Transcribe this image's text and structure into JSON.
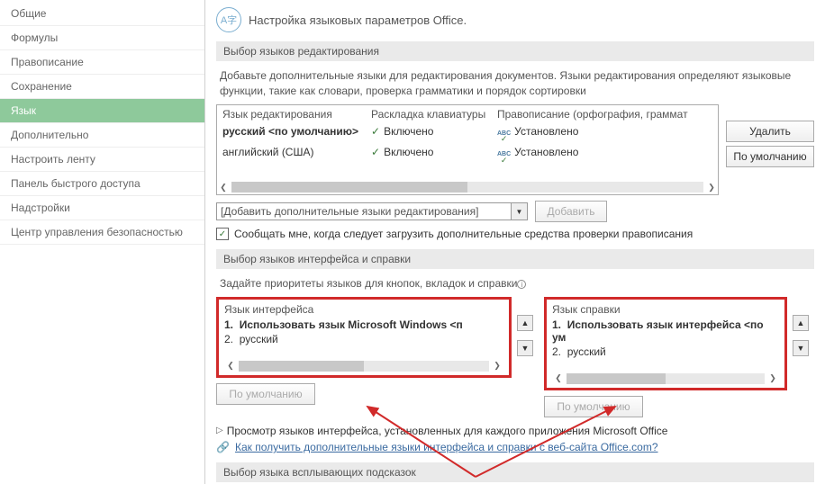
{
  "sidebar": {
    "items": [
      {
        "label": "Общие"
      },
      {
        "label": "Формулы"
      },
      {
        "label": "Правописание"
      },
      {
        "label": "Сохранение"
      },
      {
        "label": "Язык",
        "selected": true
      },
      {
        "label": "Дополнительно"
      },
      {
        "label": "Настроить ленту"
      },
      {
        "label": "Панель быстрого доступа"
      },
      {
        "label": "Надстройки"
      },
      {
        "label": "Центр управления безопасностью"
      }
    ]
  },
  "header": {
    "icon_text": "A字",
    "title": "Настройка языковых параметров Office."
  },
  "editing_section": {
    "head": "Выбор языков редактирования",
    "desc": "Добавьте дополнительные языки для редактирования документов. Языки редактирования определяют языковые функции, такие как словари, проверка грамматики и порядок сортировки",
    "cols": {
      "lang": "Язык редактирования",
      "layout": "Раскладка клавиатуры",
      "proof": "Правописание (орфография, граммат"
    },
    "rows": [
      {
        "lang": "русский <по умолчанию>",
        "layout": "Включено",
        "proof": "Установлено",
        "bold": true
      },
      {
        "lang": "английский (США)",
        "layout": "Включено",
        "proof": "Установлено",
        "bold": false
      }
    ],
    "btn_delete": "Удалить",
    "btn_default": "По умолчанию",
    "combo_text": "[Добавить дополнительные языки редактирования]",
    "btn_add": "Добавить",
    "checkbox_label": "Сообщать мне, когда следует загрузить дополнительные средства проверки правописания"
  },
  "ui_section": {
    "head": "Выбор языков интерфейса и справки",
    "desc": "Задайте приоритеты языков для кнопок, вкладок и справки",
    "left": {
      "title": "Язык интерфейса",
      "items": [
        {
          "n": "1.",
          "label": "Использовать язык Microsoft Windows <п",
          "bold": true
        },
        {
          "n": "2.",
          "label": "русский",
          "bold": false
        }
      ]
    },
    "right": {
      "title": "Язык справки",
      "items": [
        {
          "n": "1.",
          "label": "Использовать язык интерфейса <по ум",
          "bold": true
        },
        {
          "n": "2.",
          "label": "русский",
          "bold": false
        }
      ]
    },
    "btn_default": "По умолчанию",
    "view_text": "Просмотр языков интерфейса, установленных для каждого приложения Microsoft Office",
    "link_text": "Как получить дополнительные языки интерфейса и справки с веб-сайта Office.com?"
  },
  "tooltip_section": {
    "head": "Выбор языка всплывающих подсказок"
  }
}
